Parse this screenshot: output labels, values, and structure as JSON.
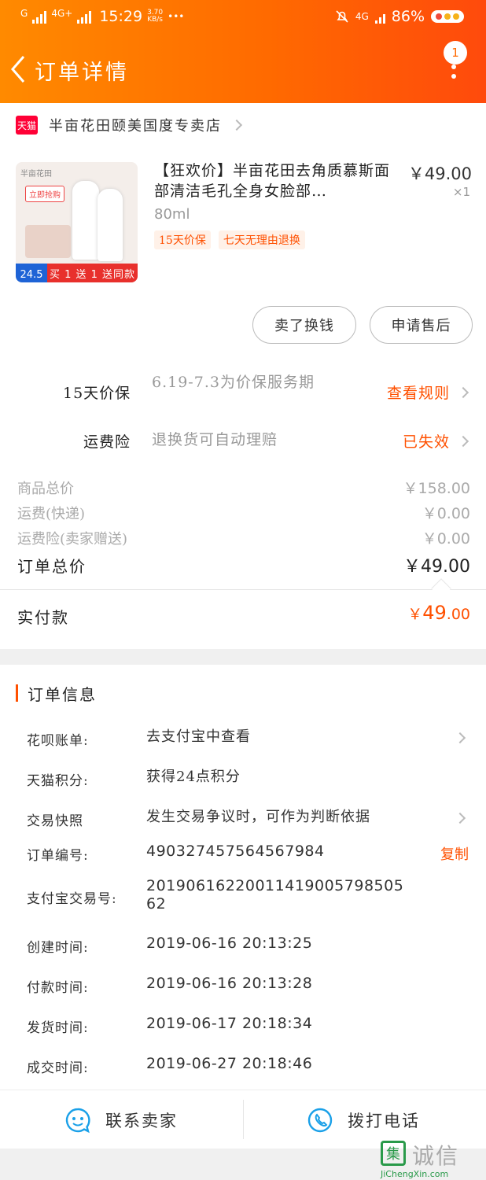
{
  "status_bar": {
    "network1": "G",
    "network2": "4G+",
    "time": "15:29",
    "speed_value": "3.70",
    "speed_unit": "KB/s",
    "dots": "•••",
    "network3": "4G",
    "battery": "86%"
  },
  "header": {
    "title": "订单详情",
    "badge": "1",
    "colors": {
      "start": "#ff8a00",
      "end": "#ff4a0c"
    }
  },
  "store": {
    "platform_badge": "天猫",
    "name": "半亩花田颐美国度专卖店"
  },
  "product": {
    "image": {
      "brand": "半亩花田",
      "grab_label": "立即抢购",
      "price_badge": "24.5",
      "promo": "买 1 送 1 送同款"
    },
    "name": "【狂欢价】半亩花田去角质慕斯面部清洁毛孔全身女脸部…",
    "price": "￥49.00",
    "quantity": "×1",
    "spec": "80ml",
    "tags": [
      "15天价保",
      "七天无理由退换"
    ]
  },
  "actions": {
    "resell": "卖了换钱",
    "after_sale": "申请售后"
  },
  "services": [
    {
      "label": "15天价保",
      "desc": "6.19-7.3为价保服务期",
      "link": "查看规则"
    },
    {
      "label": "运费险",
      "desc": "退换货可自动理赔",
      "link": "已失效"
    }
  ],
  "costs": [
    {
      "label": "商品总价",
      "value": "￥158.00"
    },
    {
      "label": "运费(快递)",
      "value": "￥0.00"
    },
    {
      "label": "运费险(卖家赠送)",
      "value": "￥0.00"
    }
  ],
  "total": {
    "label": "订单总价",
    "value": "￥49.00"
  },
  "paid": {
    "label": "实付款",
    "symbol": "￥",
    "int": "49",
    "dec": ".00"
  },
  "order_info": {
    "title": "订单信息",
    "rows": [
      {
        "label": "花呗账单:",
        "value": "去支付宝中查看"
      },
      {
        "label": "天猫积分:",
        "value": "获得24点积分"
      },
      {
        "label": "交易快照",
        "value": "发生交易争议时，可作为判断依据"
      },
      {
        "label": "订单编号:",
        "value": "490327457564567984",
        "action": "复制"
      },
      {
        "label": "支付宝交易号:",
        "value": "2019061622001141900579850562"
      },
      {
        "label": "创建时间:",
        "value": "2019-06-16 20:13:25"
      },
      {
        "label": "付款时间:",
        "value": "2019-06-16 20:13:28"
      },
      {
        "label": "发货时间:",
        "value": "2019-06-17 20:18:34"
      },
      {
        "label": "成交时间:",
        "value": "2019-06-27 20:18:46"
      }
    ]
  },
  "bottom_bar": {
    "contact": "联系卖家",
    "call": "拨打电话"
  },
  "watermark": {
    "icon": "集",
    "text": "诚信",
    "url": "JiChengXin.com"
  }
}
